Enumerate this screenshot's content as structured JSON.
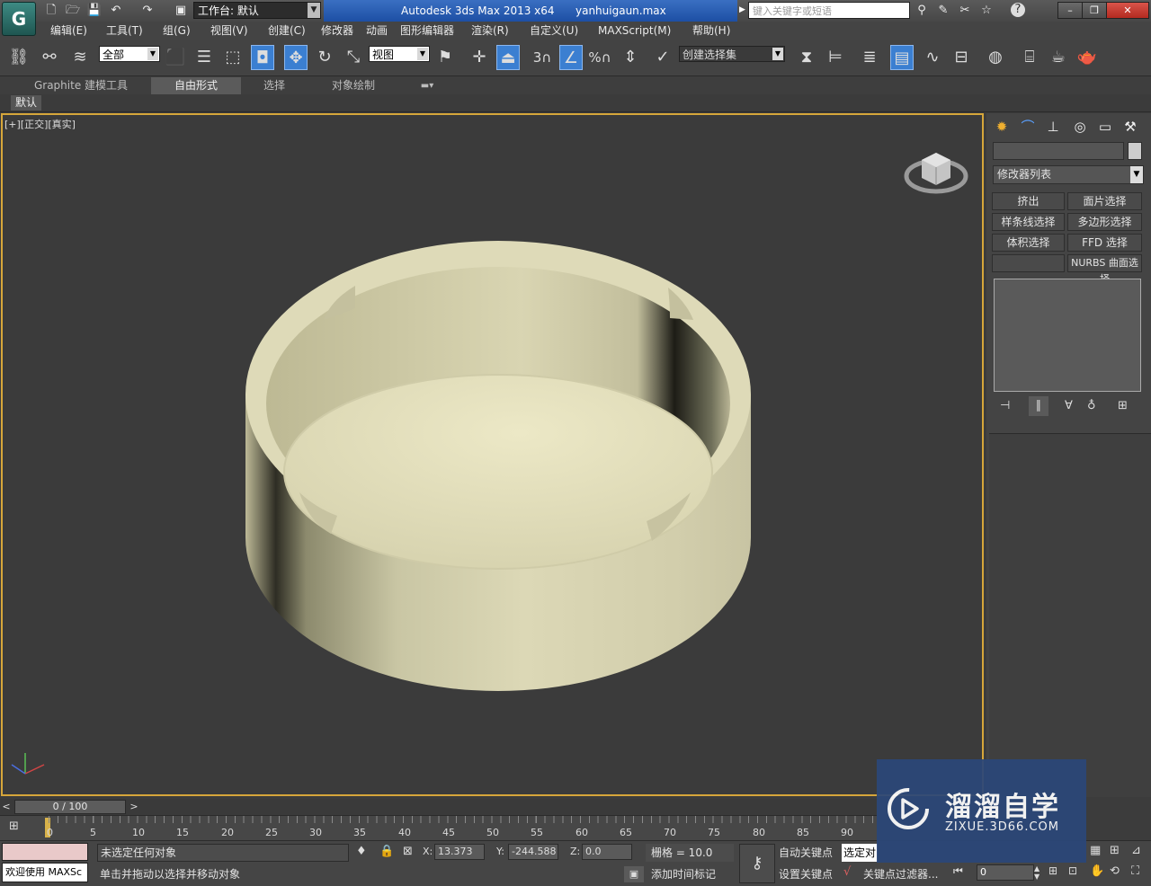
{
  "title_bar": {
    "app_logo": "G",
    "workspace_label": "工作台: 默认",
    "app_title": "Autodesk 3ds Max  2013 x64",
    "filename": "yanhuigaun.max",
    "search_placeholder": "键入关键字或短语",
    "minimize": "–",
    "restore": "❐",
    "close": "✕"
  },
  "menu": [
    "编辑(E)",
    "工具(T)",
    "组(G)",
    "视图(V)",
    "创建(C)",
    "修改器",
    "动画",
    "图形编辑器",
    "渲染(R)",
    "自定义(U)",
    "MAXScript(M)",
    "帮助(H)"
  ],
  "toolbar": {
    "selection_filter": "全部",
    "ref_coord": "视图",
    "named_selection": "创建选择集",
    "snap_3": "3",
    "percent": "%"
  },
  "ribbon": {
    "tabs": [
      "Graphite 建模工具",
      "自由形式",
      "选择",
      "对象绘制"
    ],
    "active_tab": "自由形式",
    "sub_tab": "默认"
  },
  "viewport": {
    "label": "[+][正交][真实]",
    "active_border_color": "#d6a63a",
    "object_color": "#d9d4b0"
  },
  "command_panel": {
    "modifier_list": "修改器列表",
    "buttons": [
      "挤出",
      "面片选择",
      "样条线选择",
      "多边形选择",
      "体积选择",
      "FFD 选择",
      "",
      "NURBS 曲面选择"
    ]
  },
  "timeline": {
    "frame_counter": "0 / 100",
    "ticks": [
      "0",
      "5",
      "10",
      "15",
      "20",
      "25",
      "30",
      "35",
      "40",
      "45",
      "50",
      "55",
      "60",
      "65",
      "70",
      "75",
      "80",
      "85",
      "90"
    ]
  },
  "status": {
    "welcome": "欢迎使用 MAXSc",
    "selection_status": "未选定任何对象",
    "prompt": "单击并拖动以选择并移动对象",
    "x_label": "X:",
    "x_value": "13.373",
    "y_label": "Y:",
    "y_value": "-244.588",
    "z_label": "Z:",
    "z_value": "0.0",
    "grid": "栅格 = 10.0",
    "auto_key": "自动关键点",
    "selected_dropdown": "选定对",
    "set_key": "设置关键点",
    "key_filters": "关键点过滤器...",
    "add_time_tag": "添加时间标记",
    "frame_value": "0"
  },
  "watermark": {
    "title": "溜溜自学",
    "url": "ZIXUE.3D66.COM"
  }
}
